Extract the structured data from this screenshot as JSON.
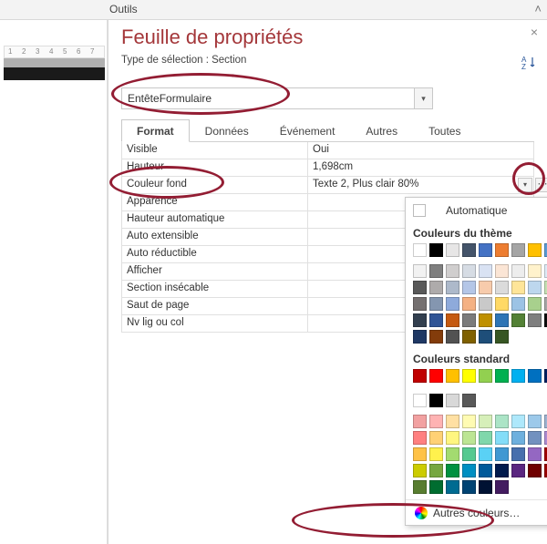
{
  "ribbon": {
    "tab": "Outils"
  },
  "sheet": {
    "title": "Feuille de propriétés",
    "selection_label": "Type de sélection : Section",
    "selector_value": "EntêteFormulaire"
  },
  "tabs": [
    "Format",
    "Données",
    "Événement",
    "Autres",
    "Toutes"
  ],
  "active_tab": 0,
  "properties": [
    {
      "label": "Visible",
      "value": "Oui"
    },
    {
      "label": "Hauteur",
      "value": "1,698cm"
    },
    {
      "label": "Couleur fond",
      "value": "Texte 2, Plus clair 80%",
      "active": true
    },
    {
      "label": "Apparence",
      "value": ""
    },
    {
      "label": "Hauteur automatique",
      "value": ""
    },
    {
      "label": "Auto extensible",
      "value": ""
    },
    {
      "label": "Auto réductible",
      "value": ""
    },
    {
      "label": "Afficher",
      "value": ""
    },
    {
      "label": "Section insécable",
      "value": ""
    },
    {
      "label": "Saut de page",
      "value": ""
    },
    {
      "label": "Nv lig ou col",
      "value": ""
    }
  ],
  "color_picker": {
    "automatic_label": "Automatique",
    "theme_label": "Couleurs du thème",
    "standard_label": "Couleurs standard",
    "more_label": "Autres couleurs…",
    "theme_row1": [
      "#ffffff",
      "#000000",
      "#e7e6e6",
      "#44546a",
      "#4472c4",
      "#ed7d31",
      "#a5a5a5",
      "#ffc000",
      "#5b9bd5",
      "#70ad47"
    ],
    "theme_tints": [
      [
        "#f2f2f2",
        "#7f7f7f",
        "#d0cece",
        "#d6dce4",
        "#d9e2f3",
        "#fbe5d5",
        "#ededed",
        "#fff2cc",
        "#deebf6",
        "#e2efd9"
      ],
      [
        "#d8d8d8",
        "#595959",
        "#aeabab",
        "#adb9ca",
        "#b4c6e7",
        "#f7cbac",
        "#dbdbdb",
        "#fee599",
        "#bdd7ee",
        "#c5e0b3"
      ],
      [
        "#bfbfbf",
        "#3f3f3f",
        "#757070",
        "#8496b0",
        "#8eaadb",
        "#f4b183",
        "#c9c9c9",
        "#ffd965",
        "#9cc3e5",
        "#a8d08d"
      ],
      [
        "#a5a5a5",
        "#262626",
        "#3a3838",
        "#323f4f",
        "#2f5496",
        "#c55a11",
        "#7b7b7b",
        "#bf9000",
        "#2e75b5",
        "#538135"
      ],
      [
        "#7f7f7f",
        "#0c0c0c",
        "#171616",
        "#222a35",
        "#1f3864",
        "#833c0b",
        "#525252",
        "#7f6000",
        "#1e4e79",
        "#375623"
      ]
    ],
    "std1": [
      "#c00000",
      "#ff0000",
      "#ffc000",
      "#ffff00",
      "#92d050",
      "#00b050",
      "#00b0f0",
      "#0070c0",
      "#002060",
      "#7030a0"
    ],
    "std2": [
      "#ffffff",
      "#000000",
      "#d8d8d8",
      "#595959"
    ],
    "std_tints": [
      [
        "#f2a1a1",
        "#ffb3b3",
        "#ffe0a3",
        "#fffbb3",
        "#d6efb9",
        "#abe4c6",
        "#aee8fb",
        "#9cc9ea",
        "#9db3d1",
        "#c6afe0"
      ],
      [
        "#e67373",
        "#ff8080",
        "#ffd175",
        "#fff680",
        "#bce594",
        "#80d7ab",
        "#84ddf8",
        "#6eb0de",
        "#7291bf",
        "#ad8bd1"
      ],
      [
        "#d94646",
        "#ff4d4d",
        "#ffc247",
        "#fff14d",
        "#a3db70",
        "#55c990",
        "#5ad1f5",
        "#4098d2",
        "#476fad",
        "#9467c2"
      ],
      [
        "#a00000",
        "#cc0000",
        "#cc9900",
        "#cccc00",
        "#76a740",
        "#009140",
        "#008fc2",
        "#005a9a",
        "#001a4d",
        "#5a2680"
      ],
      [
        "#700000",
        "#990000",
        "#997300",
        "#999900",
        "#587d30",
        "#006d30",
        "#006b91",
        "#004373",
        "#001233",
        "#431c60"
      ]
    ]
  },
  "ruler_ticks": [
    "1",
    "2",
    "3",
    "4",
    "5",
    "6",
    "7"
  ]
}
